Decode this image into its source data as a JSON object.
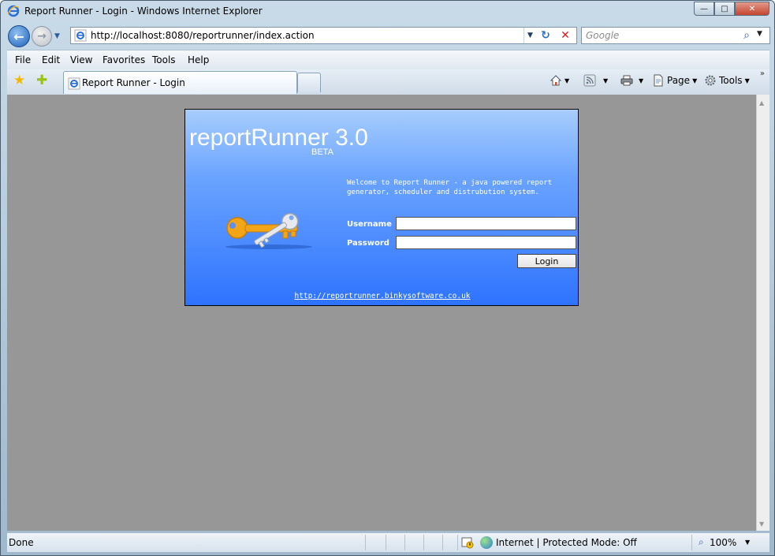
{
  "window": {
    "title": "Report Runner - Login - Windows Internet Explorer",
    "minimize": "—",
    "maximize": "□",
    "close": "✕"
  },
  "address": {
    "url": "http://localhost:8080/reportrunner/index.action",
    "refresh_glyph": "↻",
    "stop_glyph": "✕"
  },
  "search": {
    "placeholder": "Google"
  },
  "menu": [
    "File",
    "Edit",
    "View",
    "Favorites",
    "Tools",
    "Help"
  ],
  "tab": {
    "label": "Report Runner - Login"
  },
  "commandbar": {
    "page_label": "Page",
    "tools_label": "Tools"
  },
  "page": {
    "brand": "reportRunner 3.0",
    "beta": "BETA",
    "welcome": "Welcome to Report Runner - a java powered report generator, scheduler and distrubution system.",
    "username_label": "Username",
    "password_label": "Password",
    "username_value": "",
    "password_value": "",
    "login_button": "Login",
    "footer_link": "http://reportrunner.binkysoftware.co.uk"
  },
  "status": {
    "text": "Done",
    "zone": "Internet | Protected Mode: Off",
    "zoom": "100%"
  },
  "colors": {
    "panel_top": "#a7cdfc",
    "panel_bottom": "#2e73ff",
    "content_bg": "#979797"
  },
  "icons": {
    "back": "back-arrow-icon",
    "forward": "forward-arrow-icon",
    "favorites": "star-icon",
    "add_favorites": "add-favorite-icon",
    "home": "home-icon",
    "feeds": "rss-feed-icon",
    "print": "printer-icon",
    "page": "page-icon",
    "tools": "gear-icon",
    "keys": "keys-icon"
  }
}
